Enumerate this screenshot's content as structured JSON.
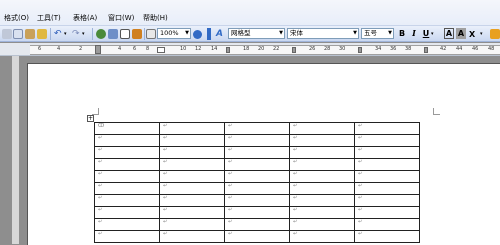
{
  "menu": [
    {
      "label": "格式(O)"
    },
    {
      "label": "工具(T)"
    },
    {
      "label": "表格(A)"
    },
    {
      "label": "窗口(W)"
    },
    {
      "label": "帮助(H)"
    }
  ],
  "toolbar": {
    "zoom_value": "100%",
    "style_value": "网格型",
    "font_value": "宋体",
    "size_value": "五号",
    "bold": "B",
    "italic": "I",
    "underline": "U",
    "font_color": "A",
    "char_shade": "A"
  },
  "ruler": {
    "ticks": [
      "6",
      "4",
      "2",
      "2",
      "4",
      "6",
      "8",
      "10",
      "12",
      "14",
      "18",
      "20",
      "22",
      "26",
      "28",
      "30",
      "34",
      "36",
      "38",
      "42",
      "44",
      "46",
      "48"
    ]
  },
  "table": {
    "rows": [
      [
        "ↀ",
        "↵",
        "↵",
        "↵",
        "↵"
      ],
      [
        "↵",
        "↵",
        "↵",
        "↵",
        "↵"
      ],
      [
        "↵",
        "↵",
        "↵",
        "↵",
        "↵"
      ],
      [
        "↵",
        "↵",
        "↵",
        "↵",
        "↵"
      ],
      [
        "↵",
        "↵",
        "↵",
        "↵",
        "↵"
      ],
      [
        "↵",
        "↵",
        "↵",
        "↵",
        "↵"
      ],
      [
        "↵",
        "↵",
        "↵",
        "↵",
        "↵"
      ],
      [
        "↵",
        "↵",
        "↵",
        "↵",
        "↵"
      ],
      [
        "↵",
        "↵",
        "↵",
        "↵",
        "↵"
      ],
      [
        "↵",
        "↵",
        "↵",
        "↵",
        "↵"
      ]
    ]
  },
  "colors": {
    "accent": "#316ac5",
    "toolbar": "#cad8f1",
    "page": "#ffffff",
    "workspace": "#8e8e8e"
  }
}
